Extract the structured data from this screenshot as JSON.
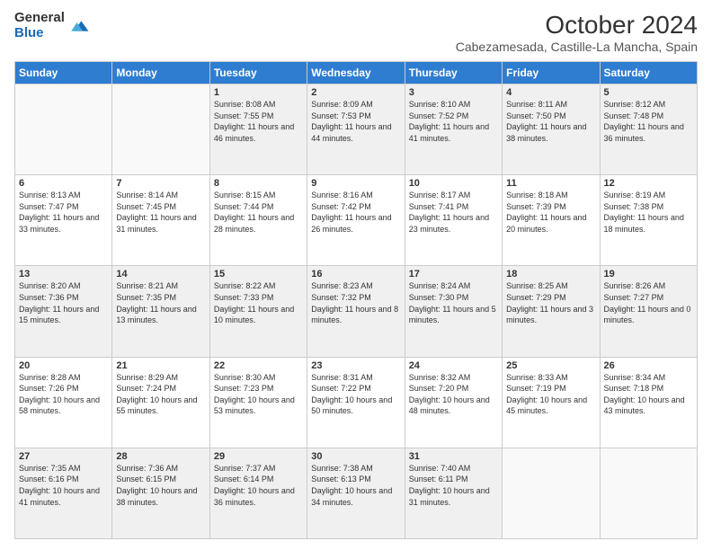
{
  "header": {
    "logo_general": "General",
    "logo_blue": "Blue",
    "main_title": "October 2024",
    "subtitle": "Cabezamesada, Castille-La Mancha, Spain"
  },
  "weekdays": [
    "Sunday",
    "Monday",
    "Tuesday",
    "Wednesday",
    "Thursday",
    "Friday",
    "Saturday"
  ],
  "weeks": [
    [
      {
        "day": "",
        "info": ""
      },
      {
        "day": "",
        "info": ""
      },
      {
        "day": "1",
        "info": "Sunrise: 8:08 AM\nSunset: 7:55 PM\nDaylight: 11 hours and 46 minutes."
      },
      {
        "day": "2",
        "info": "Sunrise: 8:09 AM\nSunset: 7:53 PM\nDaylight: 11 hours and 44 minutes."
      },
      {
        "day": "3",
        "info": "Sunrise: 8:10 AM\nSunset: 7:52 PM\nDaylight: 11 hours and 41 minutes."
      },
      {
        "day": "4",
        "info": "Sunrise: 8:11 AM\nSunset: 7:50 PM\nDaylight: 11 hours and 38 minutes."
      },
      {
        "day": "5",
        "info": "Sunrise: 8:12 AM\nSunset: 7:48 PM\nDaylight: 11 hours and 36 minutes."
      }
    ],
    [
      {
        "day": "6",
        "info": "Sunrise: 8:13 AM\nSunset: 7:47 PM\nDaylight: 11 hours and 33 minutes."
      },
      {
        "day": "7",
        "info": "Sunrise: 8:14 AM\nSunset: 7:45 PM\nDaylight: 11 hours and 31 minutes."
      },
      {
        "day": "8",
        "info": "Sunrise: 8:15 AM\nSunset: 7:44 PM\nDaylight: 11 hours and 28 minutes."
      },
      {
        "day": "9",
        "info": "Sunrise: 8:16 AM\nSunset: 7:42 PM\nDaylight: 11 hours and 26 minutes."
      },
      {
        "day": "10",
        "info": "Sunrise: 8:17 AM\nSunset: 7:41 PM\nDaylight: 11 hours and 23 minutes."
      },
      {
        "day": "11",
        "info": "Sunrise: 8:18 AM\nSunset: 7:39 PM\nDaylight: 11 hours and 20 minutes."
      },
      {
        "day": "12",
        "info": "Sunrise: 8:19 AM\nSunset: 7:38 PM\nDaylight: 11 hours and 18 minutes."
      }
    ],
    [
      {
        "day": "13",
        "info": "Sunrise: 8:20 AM\nSunset: 7:36 PM\nDaylight: 11 hours and 15 minutes."
      },
      {
        "day": "14",
        "info": "Sunrise: 8:21 AM\nSunset: 7:35 PM\nDaylight: 11 hours and 13 minutes."
      },
      {
        "day": "15",
        "info": "Sunrise: 8:22 AM\nSunset: 7:33 PM\nDaylight: 11 hours and 10 minutes."
      },
      {
        "day": "16",
        "info": "Sunrise: 8:23 AM\nSunset: 7:32 PM\nDaylight: 11 hours and 8 minutes."
      },
      {
        "day": "17",
        "info": "Sunrise: 8:24 AM\nSunset: 7:30 PM\nDaylight: 11 hours and 5 minutes."
      },
      {
        "day": "18",
        "info": "Sunrise: 8:25 AM\nSunset: 7:29 PM\nDaylight: 11 hours and 3 minutes."
      },
      {
        "day": "19",
        "info": "Sunrise: 8:26 AM\nSunset: 7:27 PM\nDaylight: 11 hours and 0 minutes."
      }
    ],
    [
      {
        "day": "20",
        "info": "Sunrise: 8:28 AM\nSunset: 7:26 PM\nDaylight: 10 hours and 58 minutes."
      },
      {
        "day": "21",
        "info": "Sunrise: 8:29 AM\nSunset: 7:24 PM\nDaylight: 10 hours and 55 minutes."
      },
      {
        "day": "22",
        "info": "Sunrise: 8:30 AM\nSunset: 7:23 PM\nDaylight: 10 hours and 53 minutes."
      },
      {
        "day": "23",
        "info": "Sunrise: 8:31 AM\nSunset: 7:22 PM\nDaylight: 10 hours and 50 minutes."
      },
      {
        "day": "24",
        "info": "Sunrise: 8:32 AM\nSunset: 7:20 PM\nDaylight: 10 hours and 48 minutes."
      },
      {
        "day": "25",
        "info": "Sunrise: 8:33 AM\nSunset: 7:19 PM\nDaylight: 10 hours and 45 minutes."
      },
      {
        "day": "26",
        "info": "Sunrise: 8:34 AM\nSunset: 7:18 PM\nDaylight: 10 hours and 43 minutes."
      }
    ],
    [
      {
        "day": "27",
        "info": "Sunrise: 7:35 AM\nSunset: 6:16 PM\nDaylight: 10 hours and 41 minutes."
      },
      {
        "day": "28",
        "info": "Sunrise: 7:36 AM\nSunset: 6:15 PM\nDaylight: 10 hours and 38 minutes."
      },
      {
        "day": "29",
        "info": "Sunrise: 7:37 AM\nSunset: 6:14 PM\nDaylight: 10 hours and 36 minutes."
      },
      {
        "day": "30",
        "info": "Sunrise: 7:38 AM\nSunset: 6:13 PM\nDaylight: 10 hours and 34 minutes."
      },
      {
        "day": "31",
        "info": "Sunrise: 7:40 AM\nSunset: 6:11 PM\nDaylight: 10 hours and 31 minutes."
      },
      {
        "day": "",
        "info": ""
      },
      {
        "day": "",
        "info": ""
      }
    ]
  ]
}
